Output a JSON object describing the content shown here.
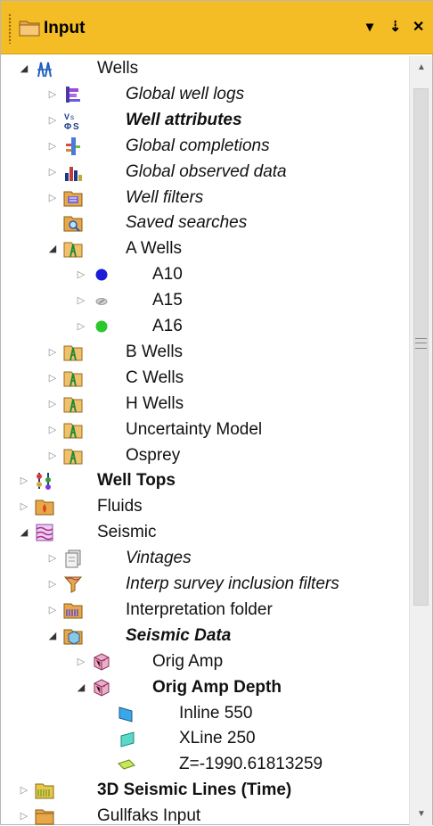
{
  "window": {
    "title": "Input",
    "controls": {
      "menu": "▾",
      "pin": "⇣",
      "close": "✕"
    }
  },
  "tree": [
    {
      "label": "Wells",
      "level": 0,
      "expander": "open",
      "icon": "wells-icon",
      "style": "normal"
    },
    {
      "label": "Global well logs",
      "level": 1,
      "expander": "closed",
      "icon": "well-logs-icon",
      "style": "italic"
    },
    {
      "label": "Well attributes",
      "level": 1,
      "expander": "closed",
      "icon": "well-attributes-icon",
      "style": "bold-italic"
    },
    {
      "label": "Global completions",
      "level": 1,
      "expander": "closed",
      "icon": "completions-icon",
      "style": "italic"
    },
    {
      "label": "Global observed data",
      "level": 1,
      "expander": "closed",
      "icon": "observed-data-icon",
      "style": "italic"
    },
    {
      "label": "Well filters",
      "level": 1,
      "expander": "closed",
      "icon": "well-filters-icon",
      "style": "italic"
    },
    {
      "label": "Saved searches",
      "level": 1,
      "expander": "none",
      "icon": "saved-searches-icon",
      "style": "italic"
    },
    {
      "label": "A Wells",
      "level": 1,
      "expander": "open",
      "icon": "well-folder-icon",
      "style": "normal"
    },
    {
      "label": "A10",
      "level": 2,
      "expander": "closed",
      "icon": "blue-dot-icon",
      "style": "normal"
    },
    {
      "label": "A15",
      "level": 2,
      "expander": "closed",
      "icon": "grey-well-icon",
      "style": "normal"
    },
    {
      "label": "A16",
      "level": 2,
      "expander": "closed",
      "icon": "green-dot-icon",
      "style": "normal"
    },
    {
      "label": "B Wells",
      "level": 1,
      "expander": "closed",
      "icon": "well-folder-icon",
      "style": "normal"
    },
    {
      "label": "C Wells",
      "level": 1,
      "expander": "closed",
      "icon": "well-folder-icon",
      "style": "normal"
    },
    {
      "label": "H Wells",
      "level": 1,
      "expander": "closed",
      "icon": "well-folder-icon",
      "style": "normal"
    },
    {
      "label": "Uncertainty Model",
      "level": 1,
      "expander": "closed",
      "icon": "well-folder-icon",
      "style": "normal"
    },
    {
      "label": "Osprey",
      "level": 1,
      "expander": "closed",
      "icon": "well-folder-icon",
      "style": "normal"
    },
    {
      "label": "Well Tops",
      "level": 0,
      "expander": "closed",
      "icon": "well-tops-icon",
      "style": "bold"
    },
    {
      "label": "Fluids",
      "level": 0,
      "expander": "closed",
      "icon": "fluids-icon",
      "style": "normal"
    },
    {
      "label": "Seismic",
      "level": 0,
      "expander": "open",
      "icon": "seismic-icon",
      "style": "normal"
    },
    {
      "label": "Vintages",
      "level": 1,
      "expander": "closed",
      "icon": "vintages-icon",
      "style": "italic"
    },
    {
      "label": "Interp survey inclusion filters",
      "level": 1,
      "expander": "closed",
      "icon": "survey-filters-icon",
      "style": "italic"
    },
    {
      "label": "Interpretation folder",
      "level": 1,
      "expander": "closed",
      "icon": "interpretation-folder-icon",
      "style": "normal"
    },
    {
      "label": "Seismic Data",
      "level": 1,
      "expander": "open",
      "icon": "seismic-data-icon",
      "style": "bold-italic"
    },
    {
      "label": "Orig Amp",
      "level": 2,
      "expander": "closed",
      "icon": "cube-icon",
      "style": "normal"
    },
    {
      "label": "Orig Amp Depth",
      "level": 2,
      "expander": "open",
      "icon": "cube-icon",
      "style": "bold"
    },
    {
      "label": "Inline 550",
      "level": 3,
      "expander": "none",
      "icon": "inline-plane-icon",
      "style": "normal"
    },
    {
      "label": "XLine 250",
      "level": 3,
      "expander": "none",
      "icon": "xline-plane-icon",
      "style": "normal"
    },
    {
      "label": "Z=-1990.61813259",
      "level": 3,
      "expander": "none",
      "icon": "z-slice-icon",
      "style": "normal"
    },
    {
      "label": "3D Seismic Lines (Time)",
      "level": 0,
      "expander": "closed",
      "icon": "seismic-lines-folder-icon",
      "style": "bold"
    },
    {
      "label": "Gullfaks Input",
      "level": 0,
      "expander": "closed",
      "icon": "folder-icon",
      "style": "normal"
    }
  ],
  "scrollbar": {
    "up": "▲",
    "down": "▼",
    "grip": "grip-icon"
  }
}
